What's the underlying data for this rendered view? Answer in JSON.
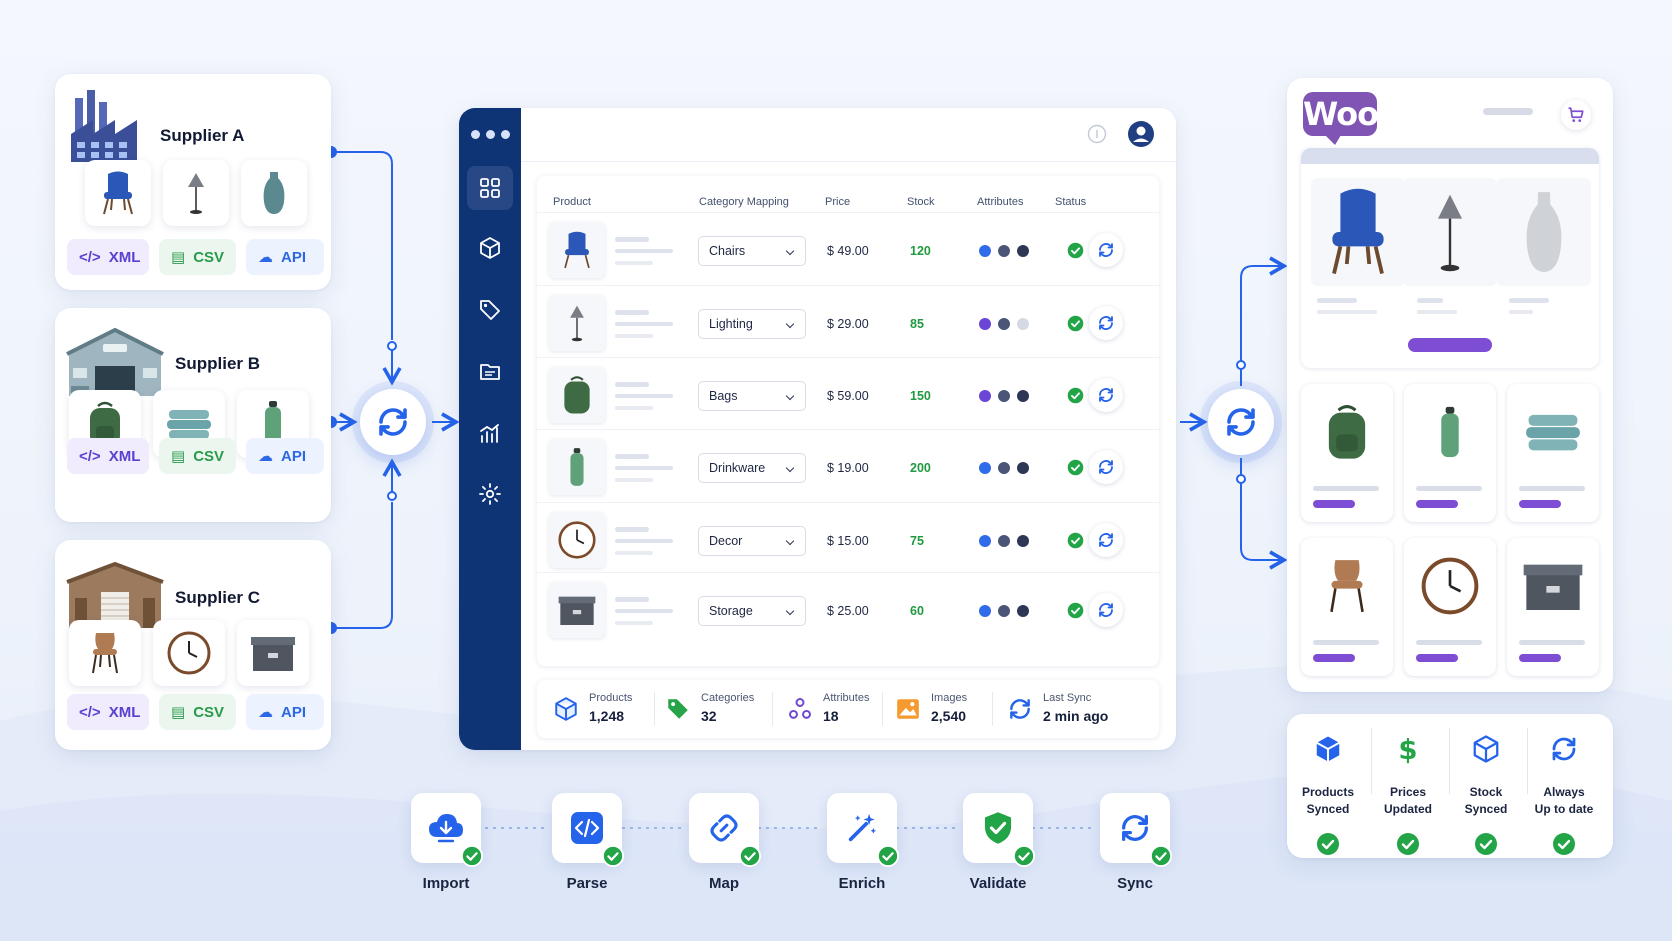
{
  "suppliers": [
    {
      "name": "Supplier A",
      "formats": [
        "XML",
        "CSV",
        "API"
      ]
    },
    {
      "name": "Supplier B",
      "formats": [
        "XML",
        "CSV",
        "API"
      ]
    },
    {
      "name": "Supplier C",
      "formats": [
        "XML",
        "CSV",
        "API"
      ]
    }
  ],
  "table": {
    "headers": {
      "product": "Product",
      "category": "Category Mapping",
      "price": "Price",
      "stock": "Stock",
      "attributes": "Attributes",
      "status": "Status"
    },
    "rows": [
      {
        "category": "Chairs",
        "price": "$ 49.00",
        "stock": "120",
        "attr_colors": [
          "#2f6bea",
          "#4a5578",
          "#2d3654"
        ]
      },
      {
        "category": "Lighting",
        "price": "$ 29.00",
        "stock": "85",
        "attr_colors": [
          "#6a45d6",
          "#4a5578",
          "#d5d9e4"
        ]
      },
      {
        "category": "Bags",
        "price": "$ 59.00",
        "stock": "150",
        "attr_colors": [
          "#6a45d6",
          "#4a5578",
          "#2d3654"
        ]
      },
      {
        "category": "Drinkware",
        "price": "$ 19.00",
        "stock": "200",
        "attr_colors": [
          "#2f6bea",
          "#4a5578",
          "#2d3654"
        ]
      },
      {
        "category": "Decor",
        "price": "$ 15.00",
        "stock": "75",
        "attr_colors": [
          "#2f6bea",
          "#4a5578",
          "#2d3654"
        ]
      },
      {
        "category": "Storage",
        "price": "$ 25.00",
        "stock": "60",
        "attr_colors": [
          "#2f6bea",
          "#4a5578",
          "#2d3654"
        ]
      }
    ]
  },
  "stats": [
    {
      "label": "Products",
      "value": "1,248"
    },
    {
      "label": "Categories",
      "value": "32"
    },
    {
      "label": "Attributes",
      "value": "18"
    },
    {
      "label": "Images",
      "value": "2,540"
    },
    {
      "label": "Last Sync",
      "value": "2 min ago"
    }
  ],
  "store": {
    "logo": "Woo"
  },
  "summary": [
    {
      "line1": "Products",
      "line2": "Synced"
    },
    {
      "line1": "Prices",
      "line2": "Updated"
    },
    {
      "line1": "Stock",
      "line2": "Synced"
    },
    {
      "line1": "Always",
      "line2": "Up to date"
    }
  ],
  "pipeline": [
    "Import",
    "Parse",
    "Map",
    "Enrich",
    "Validate",
    "Sync"
  ],
  "colors": {
    "accent": "#2563eb",
    "navy": "#0f3476",
    "woo_purple": "#7f54b3",
    "success": "#22a447"
  }
}
